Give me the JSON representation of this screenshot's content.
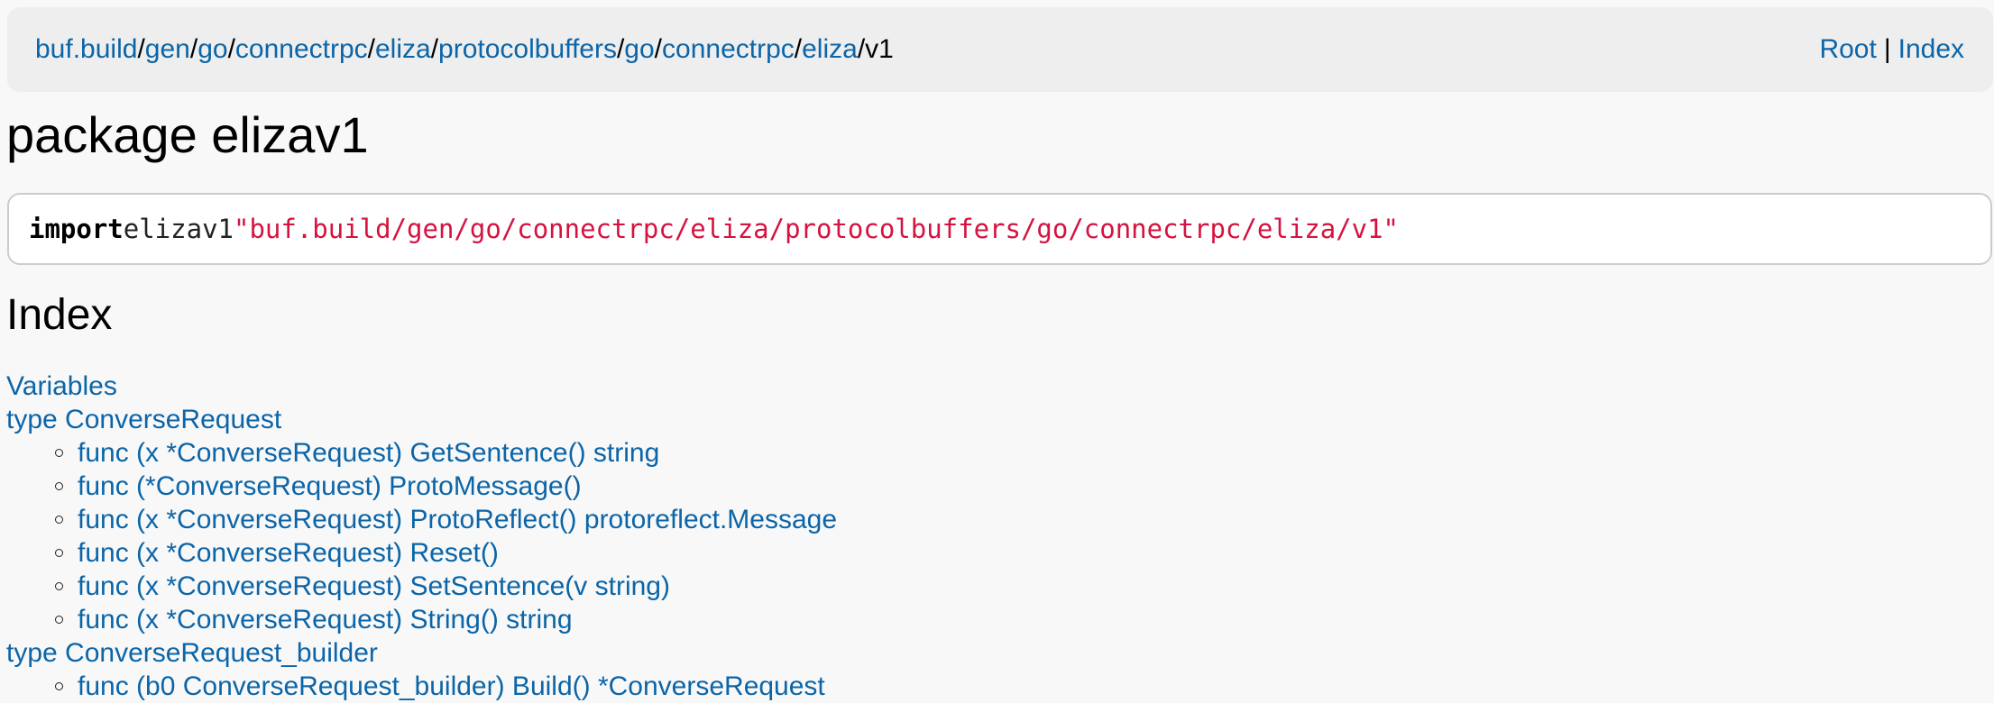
{
  "topbar": {
    "breadcrumb": [
      {
        "label": "buf.build",
        "link": true
      },
      {
        "label": "gen",
        "link": true
      },
      {
        "label": "go",
        "link": true
      },
      {
        "label": "connectrpc",
        "link": true
      },
      {
        "label": "eliza",
        "link": true
      },
      {
        "label": "protocolbuffers",
        "link": true
      },
      {
        "label": "go",
        "link": true
      },
      {
        "label": "connectrpc",
        "link": true
      },
      {
        "label": "eliza",
        "link": true
      },
      {
        "label": "v1",
        "link": false
      }
    ],
    "separator": "/",
    "root_label": "Root",
    "divider": "|",
    "index_label": "Index"
  },
  "page_title": "package elizav1",
  "import": {
    "keyword": "import",
    "alias": "elizav1",
    "path": "\"buf.build/gen/go/connectrpc/eliza/protocolbuffers/go/connectrpc/eliza/v1\""
  },
  "index": {
    "heading": "Index",
    "entries": [
      {
        "label": "Variables",
        "methods": []
      },
      {
        "label": "type ConverseRequest",
        "methods": [
          "func (x *ConverseRequest) GetSentence() string",
          "func (*ConverseRequest) ProtoMessage()",
          "func (x *ConverseRequest) ProtoReflect() protoreflect.Message",
          "func (x *ConverseRequest) Reset()",
          "func (x *ConverseRequest) SetSentence(v string)",
          "func (x *ConverseRequest) String() string"
        ]
      },
      {
        "label": "type ConverseRequest_builder",
        "methods": [
          "func (b0 ConverseRequest_builder) Build() *ConverseRequest"
        ]
      }
    ]
  },
  "colors": {
    "link": "#0b65a8",
    "string_literal": "#d6123f",
    "topbar_bg": "#eeeeee",
    "page_bg": "#f8f8f8",
    "code_border": "#cccccc"
  }
}
